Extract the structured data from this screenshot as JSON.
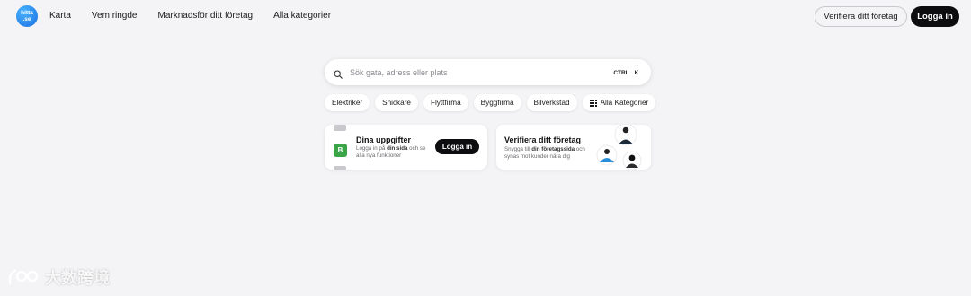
{
  "logo": {
    "text": "hitta.se",
    "line1": "hitta",
    "line2": ".se"
  },
  "nav": {
    "items": [
      {
        "label": "Karta"
      },
      {
        "label": "Vem ringde"
      },
      {
        "label": "Marknadsför ditt företag"
      },
      {
        "label": "Alla kategorier"
      }
    ]
  },
  "header": {
    "verify_label": "Verifiera ditt företag",
    "login_label": "Logga in"
  },
  "search": {
    "placeholder": "Sök gata, adress eller plats",
    "shortcut_ctrl": "CTRL",
    "shortcut_key": "K"
  },
  "chips": {
    "items": [
      {
        "label": "Elektriker"
      },
      {
        "label": "Snickare"
      },
      {
        "label": "Flyttfirma"
      },
      {
        "label": "Byggfirma"
      },
      {
        "label": "Bilverkstad"
      },
      {
        "label": "Alla Kategorier"
      }
    ]
  },
  "card_details": {
    "title": "Dina uppgifter",
    "text_pre": "Logga in på ",
    "text_bold": "din sida",
    "text_post": " och se alla nya funktioner",
    "button_label": "Logga in",
    "icon_letter": "B"
  },
  "card_verify": {
    "title": "Verifiera ditt företag",
    "text_pre": "Snygga till ",
    "text_bold": "din företagssida",
    "text_post": " och synas mot kunder nära dig"
  },
  "watermark": {
    "text": "大数跨境"
  },
  "colors": {
    "background": "#f4f4f6",
    "primary_button": "#0d0d0f",
    "logo_blue": "#1a6fe0",
    "green_icon": "#3aa548"
  }
}
